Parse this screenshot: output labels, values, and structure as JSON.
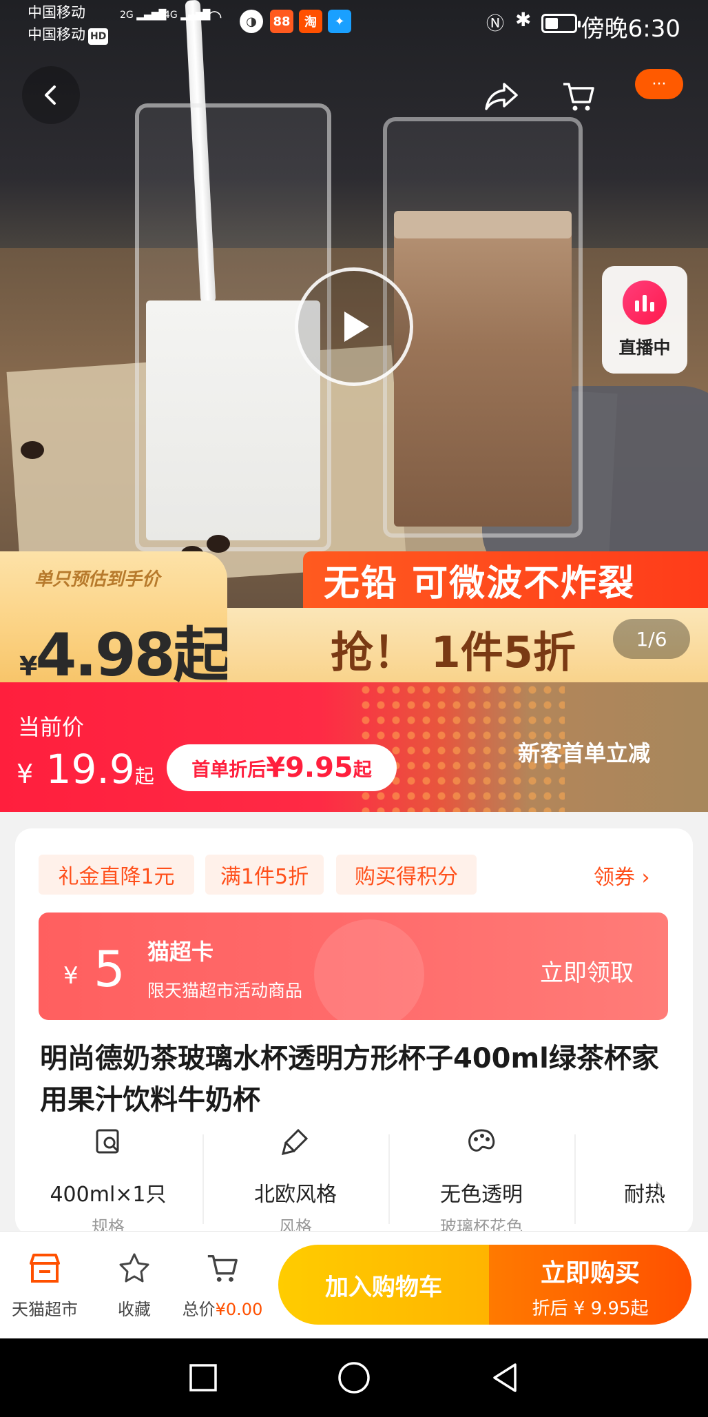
{
  "status": {
    "carrier1": "中国移动",
    "carrier2": "中国移动",
    "hd": "HD",
    "net1": "2G",
    "net2": "4G",
    "time": "傍晚6:30",
    "battery_level": 0.45,
    "app_icons": [
      "taobao-icon",
      "tmall-icon",
      "bulb-icon"
    ]
  },
  "header": {
    "icons": [
      "back-icon",
      "share-icon",
      "cart-icon",
      "more-icon"
    ],
    "more_label": "···"
  },
  "media": {
    "live_label": "直播中",
    "pager": "1/6"
  },
  "promo": {
    "estimate_label": "单只预估到手价",
    "estimate_currency": "¥",
    "estimate_price": "4.98起",
    "headline": "无铅 可微波不炸裂",
    "deal": "抢！ 1件5折"
  },
  "price": {
    "label": "当前价",
    "currency": "¥",
    "value": "19.9",
    "suffix": "起",
    "first_order_label": "首单折后 ",
    "first_order_amount": "¥9.95",
    "first_order_suffix": "起",
    "new_customer": "新客首单立减"
  },
  "offers": {
    "tags": [
      "礼金直降1元",
      "满1件5折",
      "购买得积分"
    ],
    "coupon_link": "领券"
  },
  "maochao_card": {
    "currency": "¥",
    "amount": "5",
    "title": "猫超卡",
    "subtitle": "限天猫超市活动商品",
    "claim": "立即领取"
  },
  "product": {
    "title": "明尚德奶茶玻璃水杯透明方形杯子400ml绿茶杯家用果汁饮料牛奶杯"
  },
  "specs": [
    {
      "icon": "spec-size-icon",
      "value": "400ml×1只",
      "label": "规格"
    },
    {
      "icon": "brush-icon",
      "value": "北欧风格",
      "label": "风格"
    },
    {
      "icon": "palette-icon",
      "value": "无色透明",
      "label": "玻璃杯花色"
    },
    {
      "icon": "durable-icon",
      "value": "耐热",
      "label": ""
    }
  ],
  "actions": {
    "store": "天猫超市",
    "favorite": "收藏",
    "total_label": "总价",
    "total_value": "¥0.00",
    "add_cart": "加入购物车",
    "buy_now": "立即购买",
    "buy_now_sub": "折后 ¥ 9.95起"
  },
  "colors": {
    "brand_red": "#ff1f3d",
    "orange": "#ff5000",
    "yellow": "#ffcc00"
  }
}
